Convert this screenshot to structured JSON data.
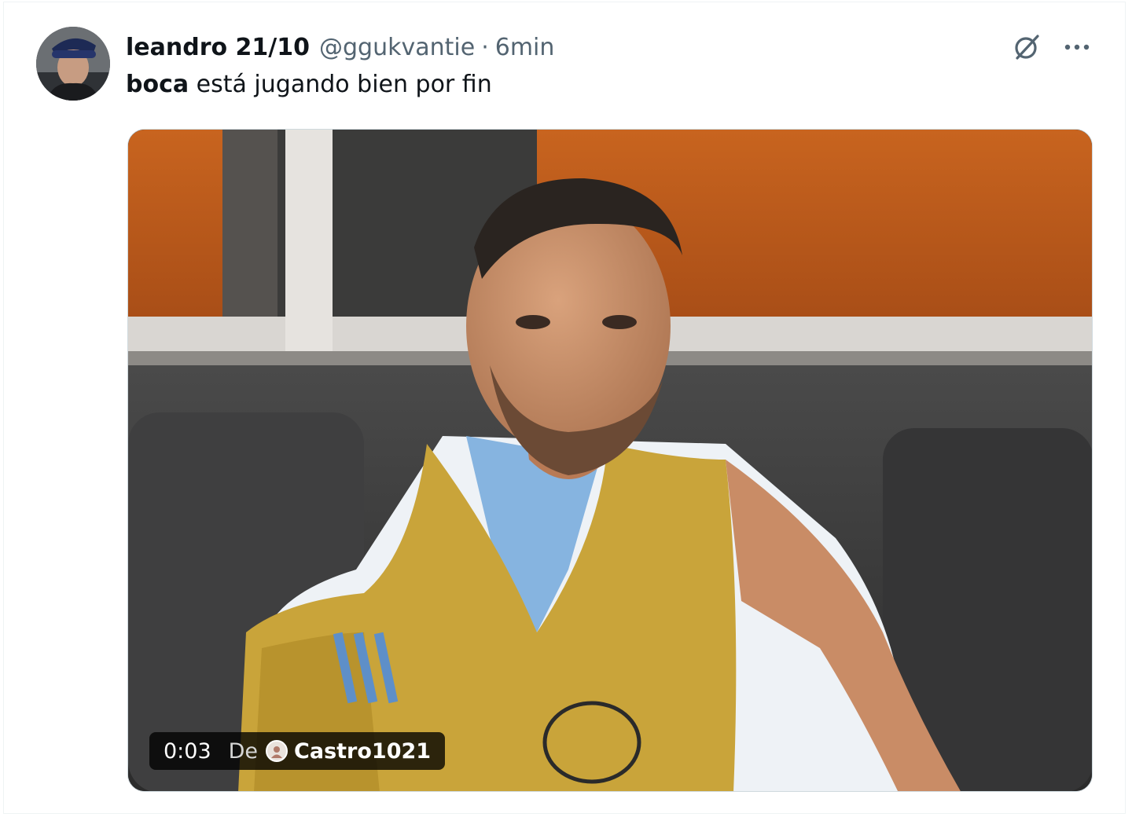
{
  "tweet": {
    "author": {
      "display_name": "leandro 21/10",
      "handle": "@ggukvantie",
      "separator": "·",
      "time": "6min",
      "avatar_icon": "user-avatar"
    },
    "text": {
      "bold": "boca",
      "rest": " está jugando bien por fin"
    },
    "actions": {
      "grok_icon": "grok-icon",
      "more_icon": "more-horizontal-icon"
    },
    "media": {
      "type": "video",
      "duration": "0:03",
      "from_label": "De",
      "source_name": "Castro1021",
      "source_avatar_icon": "source-avatar"
    }
  },
  "colors": {
    "text_primary": "#0f1419",
    "text_secondary": "#536471",
    "border": "#cfd9de",
    "overlay_bg": "#000000"
  }
}
